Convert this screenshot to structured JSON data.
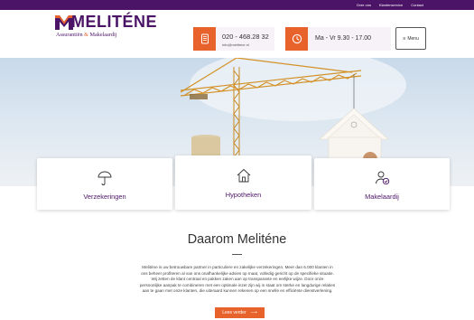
{
  "topbar": {
    "links": [
      "Over ons",
      "Klantenservice",
      "Contact"
    ]
  },
  "brand": {
    "name": "MELITÉNE",
    "tagline_part1": "Assurantiën",
    "tagline_amp": "&",
    "tagline_part2": "Makelaardij"
  },
  "contact": {
    "phone": "020 - 468.28 32",
    "email": "info@melitene.nl"
  },
  "hours": {
    "text": "Ma - Vr 9.30 - 17.00"
  },
  "menu": {
    "icon": "≡",
    "label": "Menu"
  },
  "services": [
    {
      "label": "Verzekeringen",
      "icon": "umbrella-icon"
    },
    {
      "label": "Hypotheken",
      "icon": "house-icon"
    },
    {
      "label": "Makelaardij",
      "icon": "user-check-icon"
    }
  ],
  "about": {
    "title": "Daarom Meliténe",
    "lines": [
      "Melitène is uw betrouwbare partner in particuliere en zakelijke verzekeringen. Meer dan 6.000 klanten in",
      "ons beheer profiteren al van ons onafhankelijke advies op maat, volledig gericht op de specifieke situatie.",
      "Wij zetten de klant centraal en pakken zaken aan op transparante en eerlijke wijze. Door onze",
      "persoonlijke aanpak te combineren met een optimale inzet zijn wij in staat om sterke en langdurige relaties",
      "aan te gaan met onze klanten, die uiteraard kunnen rekenen op een snelle en efficiënte dienstverlening."
    ],
    "cta": "Lees verder",
    "cta_arrow": "⟶"
  },
  "colors": {
    "brand_purple": "#4b1466",
    "accent_orange": "#e8632b"
  }
}
